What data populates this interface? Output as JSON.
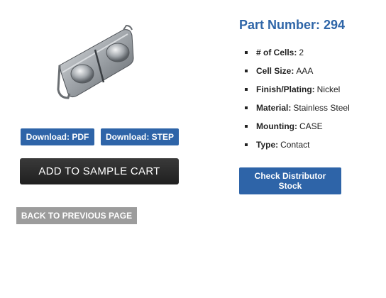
{
  "product": {
    "image_icon": "metal-clip-contact-image",
    "part_number_label": "Part Number: 294"
  },
  "downloads": {
    "pdf_label": "Download: PDF",
    "step_label": "Download: STEP"
  },
  "cart": {
    "label": "ADD TO SAMPLE CART"
  },
  "navigation": {
    "back_label": "BACK TO PREVIOUS PAGE"
  },
  "specs": [
    {
      "key": "# of Cells:",
      "value": "2"
    },
    {
      "key": "Cell Size:",
      "value": "AAA"
    },
    {
      "key": "Finish/Plating:",
      "value": "Nickel"
    },
    {
      "key": "Material:",
      "value": "Stainless Steel"
    },
    {
      "key": "Mounting:",
      "value": "CASE"
    },
    {
      "key": "Type:",
      "value": "Contact"
    }
  ],
  "distributor": {
    "line1": "Check Distributor",
    "line2": "Stock"
  },
  "colors": {
    "accent": "#2e64a8",
    "title": "#2f66a8",
    "cart_bg": "#2a2a2a",
    "back_bg": "#9c9c9c"
  }
}
